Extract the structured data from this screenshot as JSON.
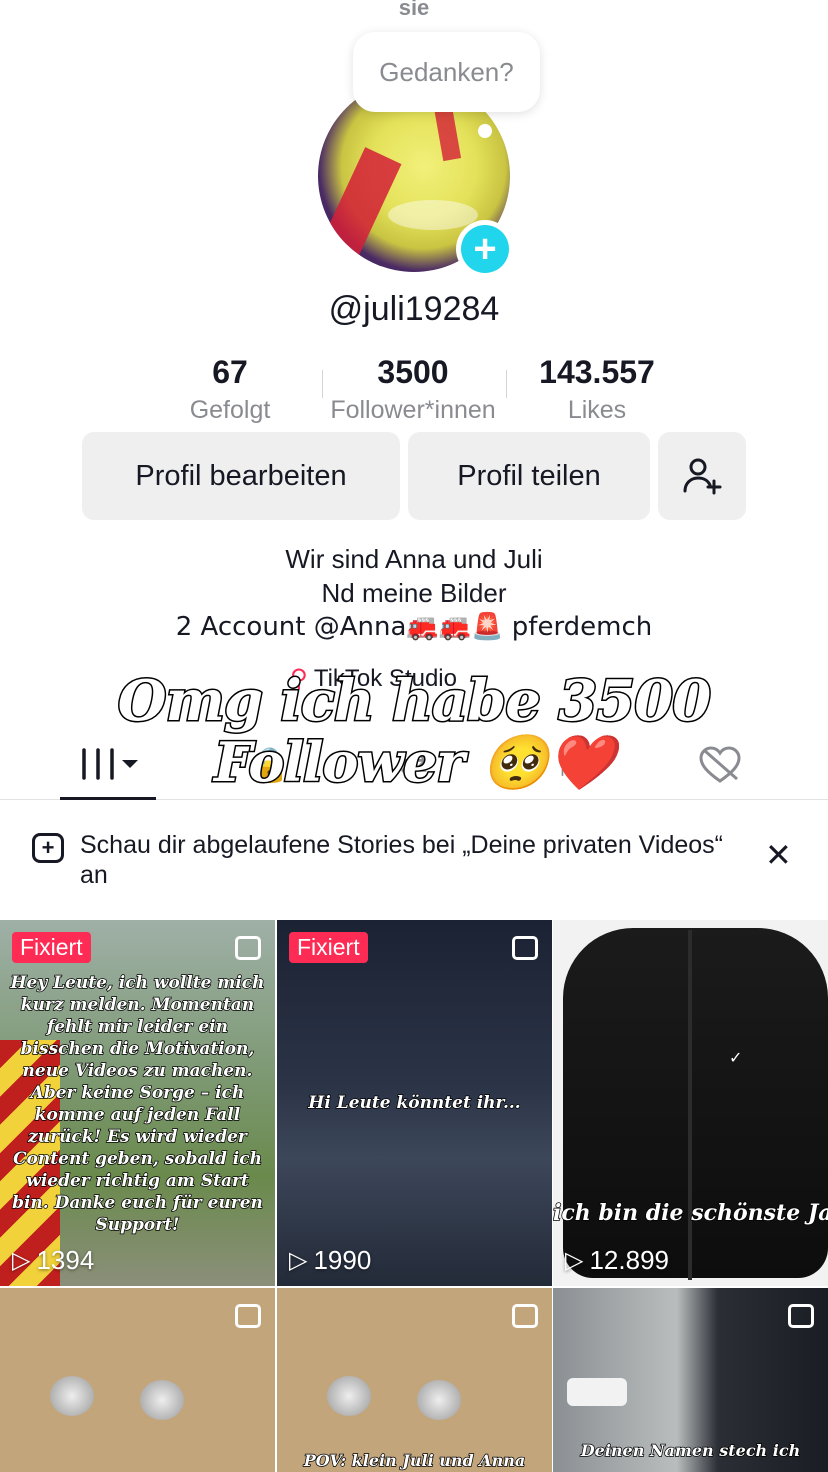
{
  "top": {
    "clipped_label": "sie"
  },
  "bubble": {
    "text": "Gedanken?"
  },
  "profile": {
    "username": "@juli19284",
    "stats": [
      {
        "num": "67",
        "label": "Gefolgt"
      },
      {
        "num": "3500",
        "label": "Follower*innen"
      },
      {
        "num": "143.557",
        "label": "Likes"
      }
    ],
    "buttons": {
      "edit": "Profil bearbeiten",
      "share": "Profil teilen"
    },
    "bio": [
      "Wir sind Anna und Juli",
      "Nd meine Bilder",
      "2 Account @Anna🚒🚒🚨 pferdemch"
    ],
    "studio": "TikTok Studio"
  },
  "overlay": {
    "line1": "Omg ich habe 3500",
    "line2": "Follower 🥺❤️"
  },
  "notice": {
    "text": "Schau dir abgelaufene Stories bei „Deine privaten Videos“ an"
  },
  "videos": [
    {
      "badge": "Fixiert",
      "views": "1394",
      "caption": "Hey Leute, ich wollte mich kurz melden. Momentan fehlt mir leider ein bisschen die Motivation, neue Videos zu machen. Aber keine Sorge – ich komme auf jeden Fall zurück! Es wird wieder Content geben, sobald ich wieder richtig am Start bin. Danke euch für euren Support!"
    },
    {
      "badge": "Fixiert",
      "views": "1990",
      "caption": "Hi Leute könntet ihr..."
    },
    {
      "badge": "",
      "views": "12.899",
      "caption": "ich bin die schönste Jacke"
    },
    {
      "caption": ""
    },
    {
      "caption": "POV: klein Juli und Anna"
    },
    {
      "caption": "Deinen Namen stech ich"
    }
  ],
  "colors": {
    "accent": "#fe2c55",
    "plus": "#20d5ec",
    "muted": "#8a8b91"
  }
}
